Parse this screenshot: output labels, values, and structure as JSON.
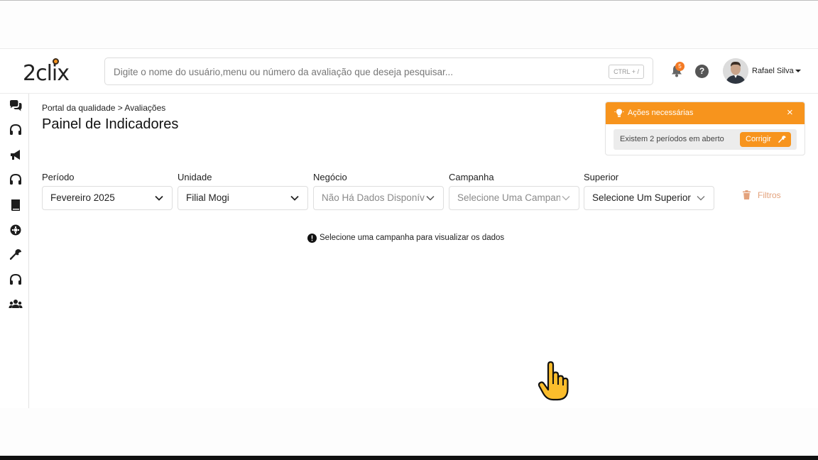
{
  "brand": {
    "logo_text": "2clix",
    "accent": "#f7941d"
  },
  "header": {
    "search_placeholder": "Digite o nome do usuário,menu ou número da avaliação que deseja pesquisar...",
    "search_shortcut": "CTRL + /",
    "notifications_count": "5",
    "help_label": "?",
    "user_name": "Rafael Silva"
  },
  "sidebar": {
    "items": [
      {
        "icon": "chat-icon"
      },
      {
        "icon": "headset-icon"
      },
      {
        "icon": "megaphone-icon"
      },
      {
        "icon": "headset-icon"
      },
      {
        "icon": "book-icon"
      },
      {
        "icon": "brain-gear-icon"
      },
      {
        "icon": "wrench-icon"
      },
      {
        "icon": "headset-icon"
      },
      {
        "icon": "users-icon"
      }
    ]
  },
  "page": {
    "breadcrumb": "Portal da qualidade > Avaliações",
    "title": "Painel de Indicadores"
  },
  "alert": {
    "title": "Ações necessárias",
    "close": "×",
    "message": "Existem 2 períodos em aberto",
    "action_label": "Corrigir"
  },
  "filters": {
    "periodo": {
      "label": "Período",
      "value": "Fevereiro 2025"
    },
    "unidade": {
      "label": "Unidade",
      "value": "Filial Mogi"
    },
    "negocio": {
      "label": "Negócio",
      "value": "Não Há Dados Disponíveis"
    },
    "campanha": {
      "label": "Campanha",
      "value": "Selecione Uma Campanha"
    },
    "superior": {
      "label": "Superior",
      "value": "Selecione Um Superior"
    },
    "clear_label": "Filtros"
  },
  "empty_state": {
    "message": "Selecione uma campanha para visualizar os dados"
  }
}
